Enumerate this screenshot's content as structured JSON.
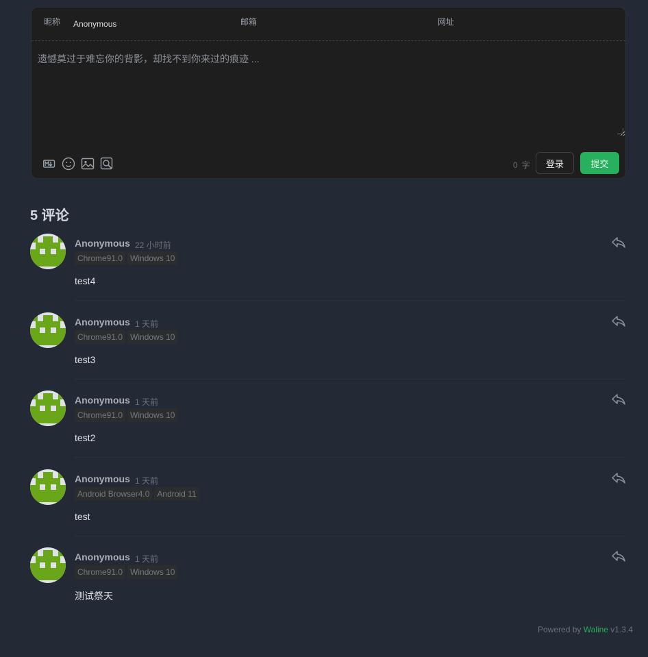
{
  "editor": {
    "fields": [
      {
        "label": "昵称",
        "value": "Anonymous"
      },
      {
        "label": "邮箱",
        "value": ""
      },
      {
        "label": "网址",
        "value": ""
      }
    ],
    "placeholder": "遗憾莫过于难忘你的背影，却找不到你来过的痕迹 ...",
    "tools": [
      "markdown-icon",
      "emoji-icon",
      "image-icon",
      "preview-icon"
    ],
    "word_count": "0",
    "word_unit": "字",
    "login_label": "登录",
    "submit_label": "提交"
  },
  "comment_count_title": "5 评论",
  "comments": [
    {
      "nick": "Anonymous",
      "time": "22 小时前",
      "badges": [
        "Chrome91.0",
        "Windows 10"
      ],
      "text": "test4"
    },
    {
      "nick": "Anonymous",
      "time": "1 天前",
      "badges": [
        "Chrome91.0",
        "Windows 10"
      ],
      "text": "test3"
    },
    {
      "nick": "Anonymous",
      "time": "1 天前",
      "badges": [
        "Chrome91.0",
        "Windows 10"
      ],
      "text": "test2"
    },
    {
      "nick": "Anonymous",
      "time": "1 天前",
      "badges": [
        "Android Browser4.0",
        "Android 11"
      ],
      "text": "test"
    },
    {
      "nick": "Anonymous",
      "time": "1 天前",
      "badges": [
        "Chrome91.0",
        "Windows 10"
      ],
      "text": "测试祭天"
    }
  ],
  "footer": {
    "prefix": "Powered by",
    "brand": "Waline",
    "version": "v1.3.4"
  },
  "colors": {
    "accent": "#27b05e",
    "avatar_green": "#6aa61a",
    "background": "#232a35"
  }
}
